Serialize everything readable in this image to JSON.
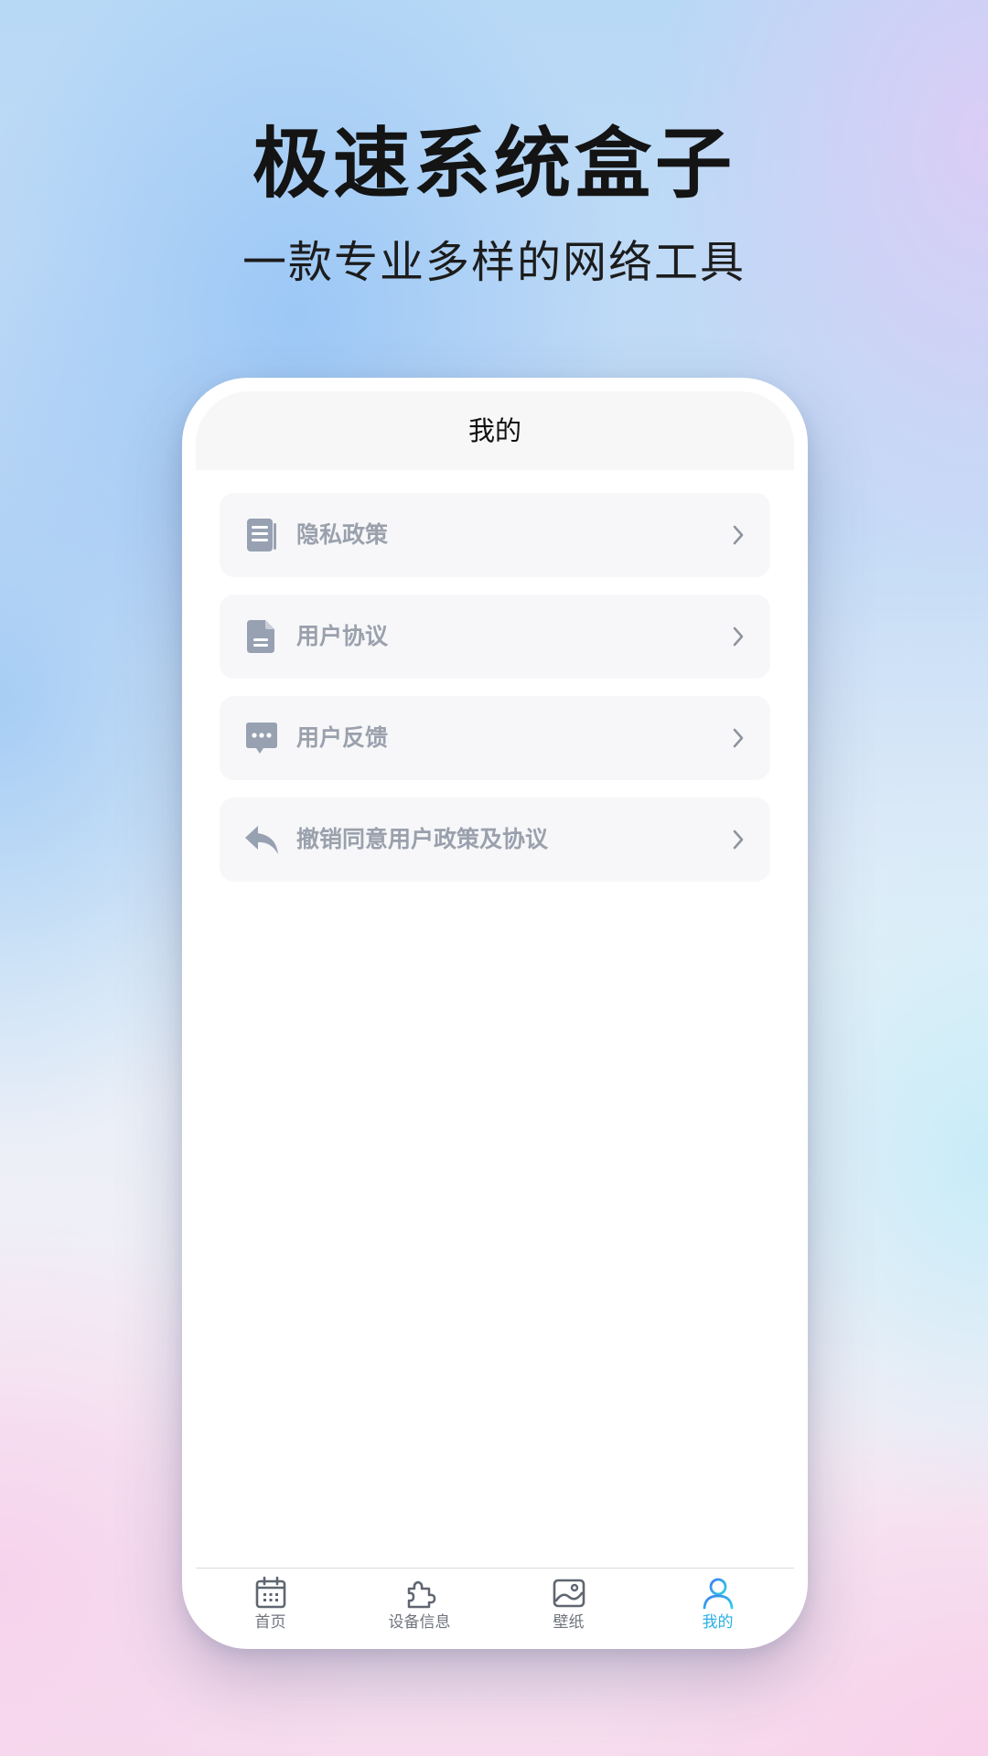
{
  "promo": {
    "headline": "极速系统盒子",
    "subline": "一款专业多样的网络工具"
  },
  "app": {
    "title": "我的",
    "menu": [
      {
        "label": "隐私政策",
        "icon": "document-list-icon"
      },
      {
        "label": "用户协议",
        "icon": "file-icon"
      },
      {
        "label": "用户反馈",
        "icon": "chat-bubble-icon"
      },
      {
        "label": "撤销同意用户政策及协议",
        "icon": "undo-arrow-icon"
      }
    ],
    "tabs": [
      {
        "label": "首页",
        "icon": "calendar-icon"
      },
      {
        "label": "设备信息",
        "icon": "puzzle-icon"
      },
      {
        "label": "壁纸",
        "icon": "image-icon"
      },
      {
        "label": "我的",
        "icon": "user-icon",
        "active": true
      }
    ]
  },
  "colors": {
    "menu_text": "#9aa1ad",
    "menu_icon": "#97a1b2",
    "tab_text": "#6f747d",
    "tab_active_start": "#3a7ef2",
    "tab_active_end": "#2cd3e6"
  }
}
